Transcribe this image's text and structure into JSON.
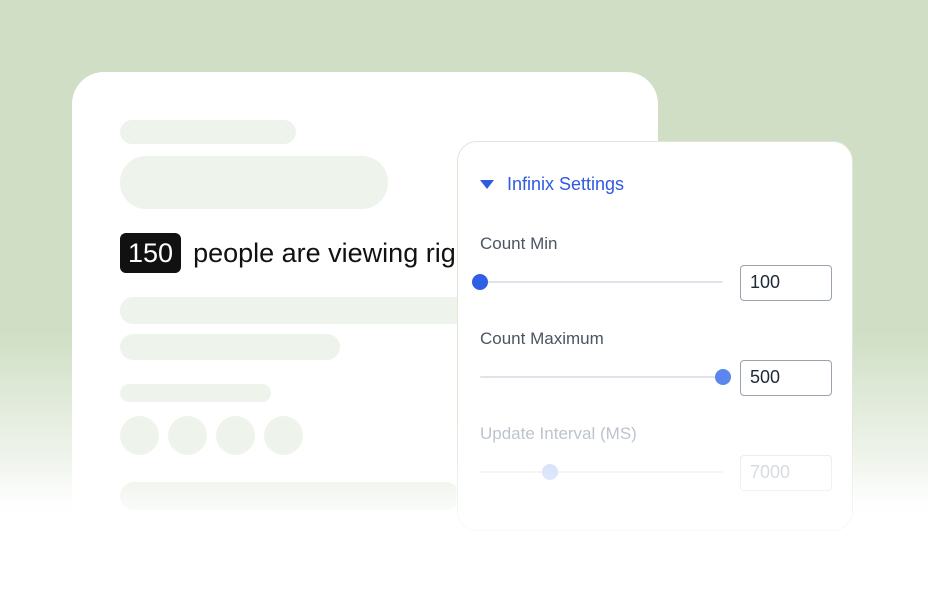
{
  "preview": {
    "count": "150",
    "viewing_text": "people are viewing right now"
  },
  "settings": {
    "title": "Infinix Settings",
    "count_min": {
      "label": "Count Min",
      "value": "100",
      "slider_fraction": 0.0
    },
    "count_max": {
      "label": "Count Maximum",
      "value": "500",
      "slider_fraction": 1.0
    },
    "update_interval": {
      "label": "Update Interval (MS)",
      "value": "7000",
      "slider_fraction": 0.29
    }
  },
  "colors": {
    "background_green": "#cfdec4",
    "accent_blue": "#2e5be0",
    "badge_black": "#111111"
  }
}
